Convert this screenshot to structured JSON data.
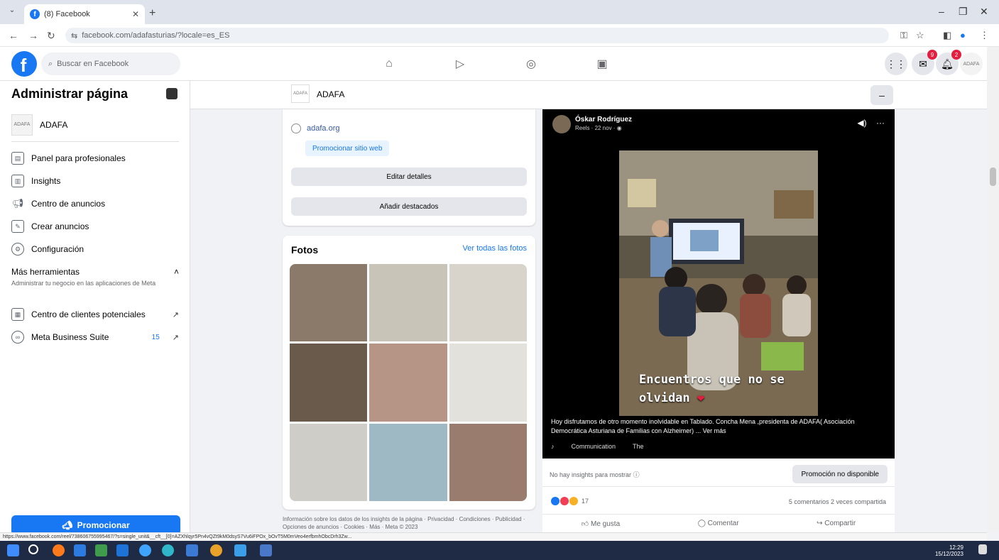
{
  "browser": {
    "tab_title": "(8) Facebook",
    "url": "facebook.com/adafasturias/?locale=es_ES"
  },
  "fb": {
    "search_placeholder": "Buscar en Facebook",
    "badges": {
      "messenger": "9",
      "notifications": "2"
    }
  },
  "sidebar": {
    "title": "Administrar página",
    "page_name": "ADAFA",
    "items": [
      {
        "label": "Panel para profesionales",
        "icon": "dashboard-icon"
      },
      {
        "label": "Insights",
        "icon": "insights-icon"
      },
      {
        "label": "Centro de anuncios",
        "icon": "megaphone-icon"
      },
      {
        "label": "Crear anuncios",
        "icon": "edit-icon"
      },
      {
        "label": "Configuración",
        "icon": "gear-icon"
      }
    ],
    "more_tools": {
      "title": "Más herramientas",
      "subtitle": "Administrar tu negocio en las aplicaciones de Meta"
    },
    "leads_center": "Centro de clientes potenciales",
    "business_suite": "Meta Business Suite",
    "business_suite_count": "15",
    "promote": "Promocionar"
  },
  "page_header": {
    "name": "ADAFA"
  },
  "intro": {
    "website": "adafa.org",
    "promote_site": "Promocionar sitio web",
    "edit_details": "Editar detalles",
    "add_featured": "Añadir destacados"
  },
  "photos": {
    "title": "Fotos",
    "see_all": "Ver todas las fotos",
    "colors": [
      "#8b7a6a",
      "#c9c4b8",
      "#d8d4cc",
      "#6a5a4c",
      "#b69486",
      "#e2e1dc",
      "#cfcdc7",
      "#9eb8c4",
      "#9a7c6e"
    ]
  },
  "footer_note": "Información sobre los datos de los insights de la página · Privacidad · Condiciones · Publicidad · Opciones de anuncios · Cookies · Más · Meta © 2023",
  "post": {
    "author": "Óskar Rodríguez",
    "meta": "Reels · 22 nov · ",
    "overlay_line1": "Encuentros que no se",
    "overlay_line2": "olvidan",
    "heart": "❤",
    "caption": "Hoy disfrutamos de otro momento inolvidable en Tablado. Concha Mena ,presidenta de ADAFA( Asociación Democrática Asturiana de Familias con Alzheimer) ... Ver más",
    "audio": "Communication",
    "audio2": "The",
    "no_insights": "No hay insights para mostrar",
    "promo_unavailable": "Promoción no disponible",
    "reaction_count": "17",
    "comments_shares": "5 comentarios  2 veces compartida",
    "like": "Me gusta",
    "comment": "Comentar",
    "share": "Compartir"
  },
  "status_url": "https://www.facebook.com/reel/738606755995467/?s=single_unit&__cft__[0]=AZXhlqyr5Pn4vQZt9kM0dsyS7Vu6iFPOx_bOvT5M0mVeo4erfbmhObcDrh3Zw...",
  "taskbar": {
    "time": "12:29",
    "date": "15/12/2023"
  }
}
